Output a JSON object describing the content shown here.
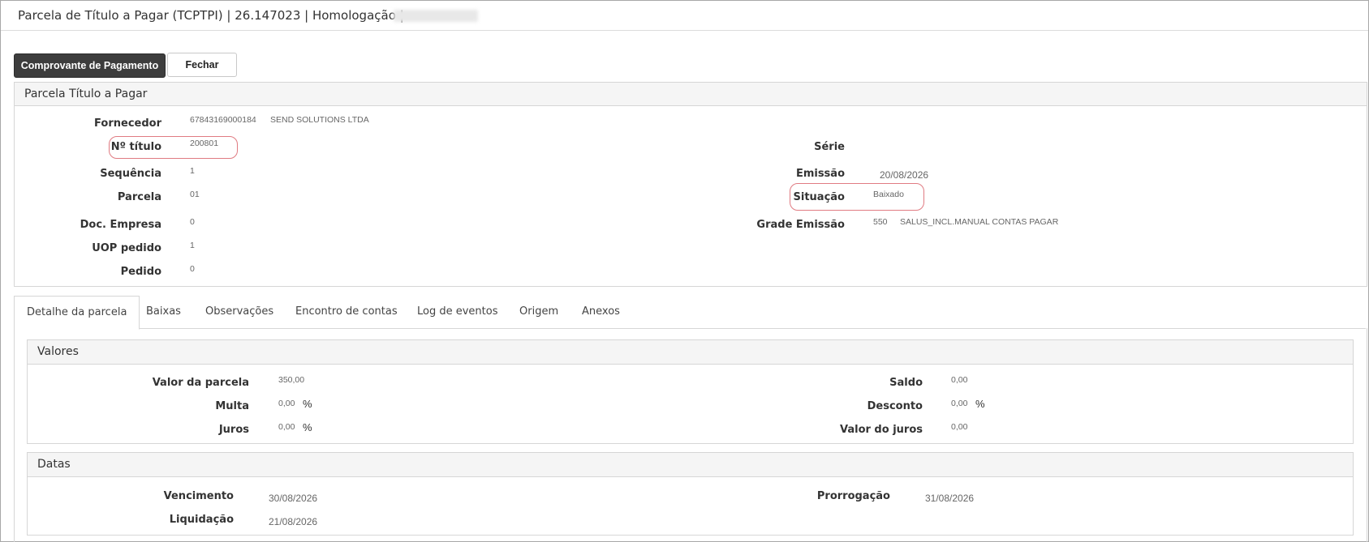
{
  "window": {
    "title": "Parcela de Título a Pagar (TCPTPI) | 26.147023 | Homologação |"
  },
  "toolbar": {
    "comprovante_label": "Comprovante de Pagamento",
    "fechar_label": "Fechar"
  },
  "header_panel": {
    "title": "Parcela Título a Pagar",
    "fornecedor": {
      "label": "Fornecedor",
      "code": "67843169000184",
      "name": "SEND SOLUTIONS LTDA"
    },
    "titulo": {
      "label": "Nº título",
      "value": "200801"
    },
    "sequencia": {
      "label": "Sequência",
      "value": "1"
    },
    "parcela": {
      "label": "Parcela",
      "value": "01"
    },
    "doc_empresa": {
      "label": "Doc. Empresa",
      "value": "0"
    },
    "uop_pedido": {
      "label": "UOP pedido",
      "value": "1"
    },
    "pedido": {
      "label": "Pedido",
      "value": "0"
    },
    "serie": {
      "label": "Série",
      "value": ""
    },
    "emissao": {
      "label": "Emissão",
      "value": "20/08/2026"
    },
    "situacao": {
      "label": "Situação",
      "value": "Baixado"
    },
    "grade_emissao": {
      "label": "Grade Emissão",
      "code": "550",
      "name": "SALUS_INCL.MANUAL CONTAS PAGAR"
    }
  },
  "tabs": [
    {
      "label": "Detalhe da parcela",
      "active": true
    },
    {
      "label": "Baixas"
    },
    {
      "label": "Observações"
    },
    {
      "label": "Encontro de contas"
    },
    {
      "label": "Log de eventos"
    },
    {
      "label": "Origem"
    },
    {
      "label": "Anexos"
    }
  ],
  "valores": {
    "title": "Valores",
    "valor_parcela": {
      "label": "Valor da parcela",
      "value": "350,00"
    },
    "multa": {
      "label": "Multa",
      "value": "0,00",
      "unit": "%"
    },
    "juros": {
      "label": "Juros",
      "value": "0,00",
      "unit": "%"
    },
    "saldo": {
      "label": "Saldo",
      "value": "0,00"
    },
    "desconto": {
      "label": "Desconto",
      "value": "0,00",
      "unit": "%"
    },
    "valor_juros": {
      "label": "Valor do juros",
      "value": "0,00"
    }
  },
  "datas": {
    "title": "Datas",
    "vencimento": {
      "label": "Vencimento",
      "value": "30/08/2026"
    },
    "liquidacao": {
      "label": "Liquidação",
      "value": "21/08/2026"
    },
    "prorrogacao": {
      "label": "Prorrogação",
      "value": "31/08/2026"
    }
  },
  "colors": {
    "highlight": "#e07b82",
    "dark_button": "#3d3d3d"
  }
}
